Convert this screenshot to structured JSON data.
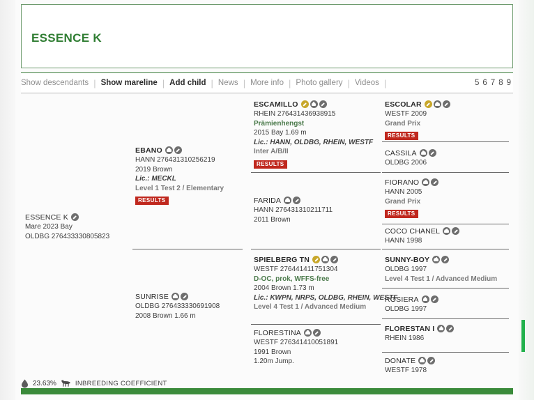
{
  "header": {
    "title": "ESSENCE K"
  },
  "nav": {
    "items": [
      {
        "label": "Show descendants",
        "style": "muted"
      },
      {
        "label": "Show mareline",
        "style": "strong"
      },
      {
        "label": "Add child",
        "style": "strong"
      },
      {
        "label": "News",
        "style": "muted"
      },
      {
        "label": "More info",
        "style": "muted"
      },
      {
        "label": "Photo gallery",
        "style": "muted"
      },
      {
        "label": "Videos",
        "style": "muted"
      }
    ],
    "separator": "|",
    "generations": [
      "5",
      "6",
      "7",
      "8",
      "9"
    ]
  },
  "pedigree": {
    "col1": [
      {
        "name": "ESSENCE K",
        "bold": false,
        "icons": [
          "pencil-icon"
        ],
        "lines": [
          {
            "text": "Mare 2023 Bay",
            "style": "plain"
          },
          {
            "text": "OLDBG 276433330805823",
            "style": "plain"
          }
        ],
        "results": false
      }
    ],
    "col2": [
      {
        "name": "EBANO",
        "bold": true,
        "icons": [
          "family-icon",
          "pencil-icon"
        ],
        "lines": [
          {
            "text": "HANN 276431310256219",
            "style": "plain"
          },
          {
            "text": "2019 Brown",
            "style": "plain"
          },
          {
            "text": "Lic.: MECKL",
            "style": "italic"
          },
          {
            "text": "Level 1 Test 2 / Elementary",
            "style": "gray-bold"
          }
        ],
        "results": true
      },
      {
        "name": "SUNRISE",
        "bold": false,
        "icons": [
          "family-icon",
          "pencil-icon"
        ],
        "lines": [
          {
            "text": "OLDBG 276433330691908",
            "style": "plain"
          },
          {
            "text": "2008 Brown 1.66 m",
            "style": "plain"
          }
        ],
        "results": false
      }
    ],
    "col3": [
      {
        "name": "ESCAMILLO",
        "bold": true,
        "icons": [
          "gold-pencil-icon",
          "family-icon",
          "pencil-icon"
        ],
        "lines": [
          {
            "text": "RHEIN 276431436938915",
            "style": "plain"
          },
          {
            "text": "Prämienhengst",
            "style": "green"
          },
          {
            "text": "2015 Bay 1.69 m",
            "style": "plain"
          },
          {
            "text": "Lic.: HANN, OLDBG, RHEIN, WESTF",
            "style": "italic"
          },
          {
            "text": "Inter A/B/II",
            "style": "gray-bold"
          }
        ],
        "results": true
      },
      {
        "name": "FARIDA",
        "bold": false,
        "icons": [
          "family-icon",
          "pencil-icon"
        ],
        "lines": [
          {
            "text": "HANN 276431310211711",
            "style": "plain"
          },
          {
            "text": "2011 Brown",
            "style": "plain"
          }
        ],
        "results": false
      },
      {
        "name": "SPIELBERG TN",
        "bold": true,
        "icons": [
          "gold-pencil-icon",
          "family-icon",
          "pencil-icon"
        ],
        "lines": [
          {
            "text": "WESTF 276441411751304",
            "style": "plain"
          },
          {
            "text": "D-OC, prok, WFFS-free",
            "style": "green"
          },
          {
            "text": "2004 Brown 1.73 m",
            "style": "plain"
          },
          {
            "text": "Lic.: KWPN, NRPS, OLDBG, RHEIN, WESTF",
            "style": "italic"
          },
          {
            "text": "Level 4 Test 1 / Advanced Medium",
            "style": "gray-bold"
          }
        ],
        "results": false
      },
      {
        "name": "FLORESTINA",
        "bold": false,
        "icons": [
          "family-icon",
          "pencil-icon"
        ],
        "lines": [
          {
            "text": "WESTF 276341410051891",
            "style": "plain"
          },
          {
            "text": "1991 Brown",
            "style": "plain"
          },
          {
            "text": "1.20m Jump.",
            "style": "plain"
          }
        ],
        "results": false
      }
    ],
    "col4": [
      {
        "name": "ESCOLAR",
        "bold": true,
        "icons": [
          "gold-pencil-icon",
          "family-icon",
          "pencil-icon"
        ],
        "lines": [
          {
            "text": "WESTF 2009",
            "style": "plain"
          },
          {
            "text": "Grand Prix",
            "style": "gray-bold"
          }
        ],
        "results": true
      },
      {
        "name": "CASSILA",
        "bold": false,
        "icons": [
          "family-icon",
          "pencil-icon"
        ],
        "lines": [
          {
            "text": "OLDBG 2006",
            "style": "plain"
          }
        ],
        "results": false
      },
      {
        "name": "FIORANO",
        "bold": false,
        "icons": [
          "family-icon",
          "pencil-icon"
        ],
        "lines": [
          {
            "text": "HANN 2005",
            "style": "plain"
          },
          {
            "text": "Grand Prix",
            "style": "gray-bold"
          }
        ],
        "results": true
      },
      {
        "name": "COCO CHANEL",
        "bold": false,
        "icons": [
          "family-icon",
          "pencil-icon"
        ],
        "lines": [
          {
            "text": "HANN 1998",
            "style": "plain"
          }
        ],
        "results": false
      },
      {
        "name": "SUNNY-BOY",
        "bold": true,
        "icons": [
          "family-icon",
          "pencil-icon"
        ],
        "lines": [
          {
            "text": "OLDBG 1997",
            "style": "plain"
          },
          {
            "text": "Level 4 Test 1 / Advanced Medium",
            "style": "gray-bold"
          }
        ],
        "results": false
      },
      {
        "name": "ROSIERA",
        "bold": false,
        "icons": [
          "family-icon",
          "pencil-icon"
        ],
        "lines": [
          {
            "text": "OLDBG 1997",
            "style": "plain"
          }
        ],
        "results": false
      },
      {
        "name": "FLORESTAN I",
        "bold": true,
        "icons": [
          "family-icon",
          "pencil-icon"
        ],
        "lines": [
          {
            "text": "RHEIN 1986",
            "style": "plain"
          }
        ],
        "results": false
      },
      {
        "name": "DONATE",
        "bold": false,
        "icons": [
          "family-icon",
          "pencil-icon"
        ],
        "lines": [
          {
            "text": "WESTF 1978",
            "style": "plain"
          }
        ],
        "results": false
      }
    ]
  },
  "results_badge_label": "RESULTS",
  "footer": {
    "inbreeding_value": "23.63%",
    "inbreeding_label": "INBREEDING COEFFICIENT"
  },
  "colors": {
    "brand_green": "#2f7d32",
    "accent_green": "#22b14c",
    "results_red": "#c0281e",
    "gold_icon": "#c8a72a",
    "gray_icon": "#6e6e6e"
  }
}
